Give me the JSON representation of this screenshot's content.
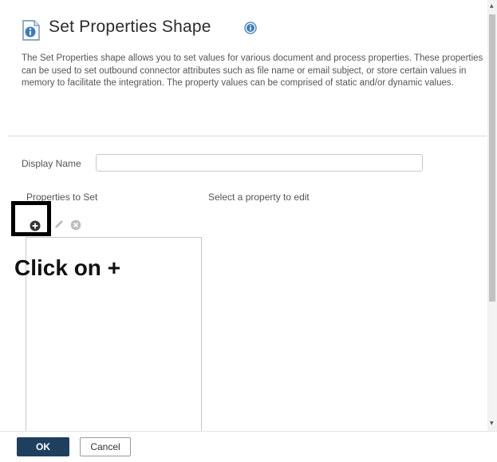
{
  "dialog": {
    "title": "Set Properties Shape",
    "description": "The Set Properties shape allows you to set values for various document and process properties. These properties can be used to set outbound connector attributes such as file name or email subject, or store certain values in memory to facilitate the integration. The property values can be comprised of static and/or dynamic values.",
    "title_icon": "shape-info-icon",
    "help_icon": "info-icon"
  },
  "form": {
    "display_name_label": "Display Name",
    "display_name_value": "",
    "properties_label": "Properties to Set",
    "select_hint": "Select a property to edit"
  },
  "toolbar": {
    "add_icon": "add-circle-icon",
    "edit_icon": "pencil-icon",
    "delete_icon": "delete-circle-icon"
  },
  "annotation": {
    "callout": "Click on +",
    "highlight_color": "#000000"
  },
  "footer": {
    "ok_label": "OK",
    "cancel_label": "Cancel"
  },
  "colors": {
    "ok_button": "#1f3f5f",
    "info_icon": "#3b7bbf"
  }
}
